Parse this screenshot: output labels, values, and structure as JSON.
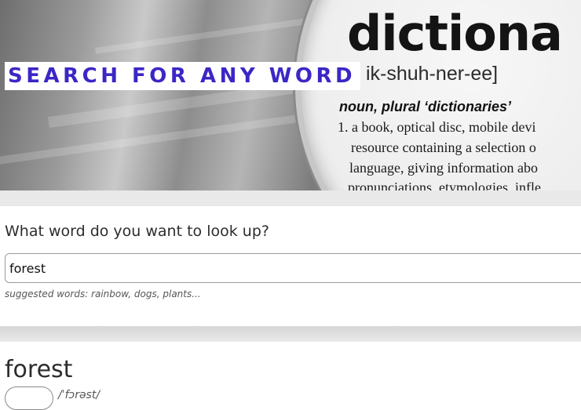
{
  "hero": {
    "title": "SEARCH FOR ANY WORD",
    "dictionary_word": "dictiona",
    "pronunciation": "ik-shuh-ner-ee]",
    "part_of_speech": "noun, plural ‘dictionaries’",
    "definition_lines": [
      "1. a book, optical disc, mobile devi",
      "resource containing a selection o",
      "language, giving information abo",
      "pronunciations, etymologies, infle"
    ]
  },
  "search": {
    "question": "What word do you want to look up?",
    "value": "forest",
    "suggestions": "suggested words: rainbow, dogs, plants..."
  },
  "result": {
    "word": "forest",
    "phonetic": "/ˈfɔrəst/"
  },
  "colors": {
    "accent": "#3b27c6"
  },
  "icons": {
    "listen": "speaker-icon"
  }
}
